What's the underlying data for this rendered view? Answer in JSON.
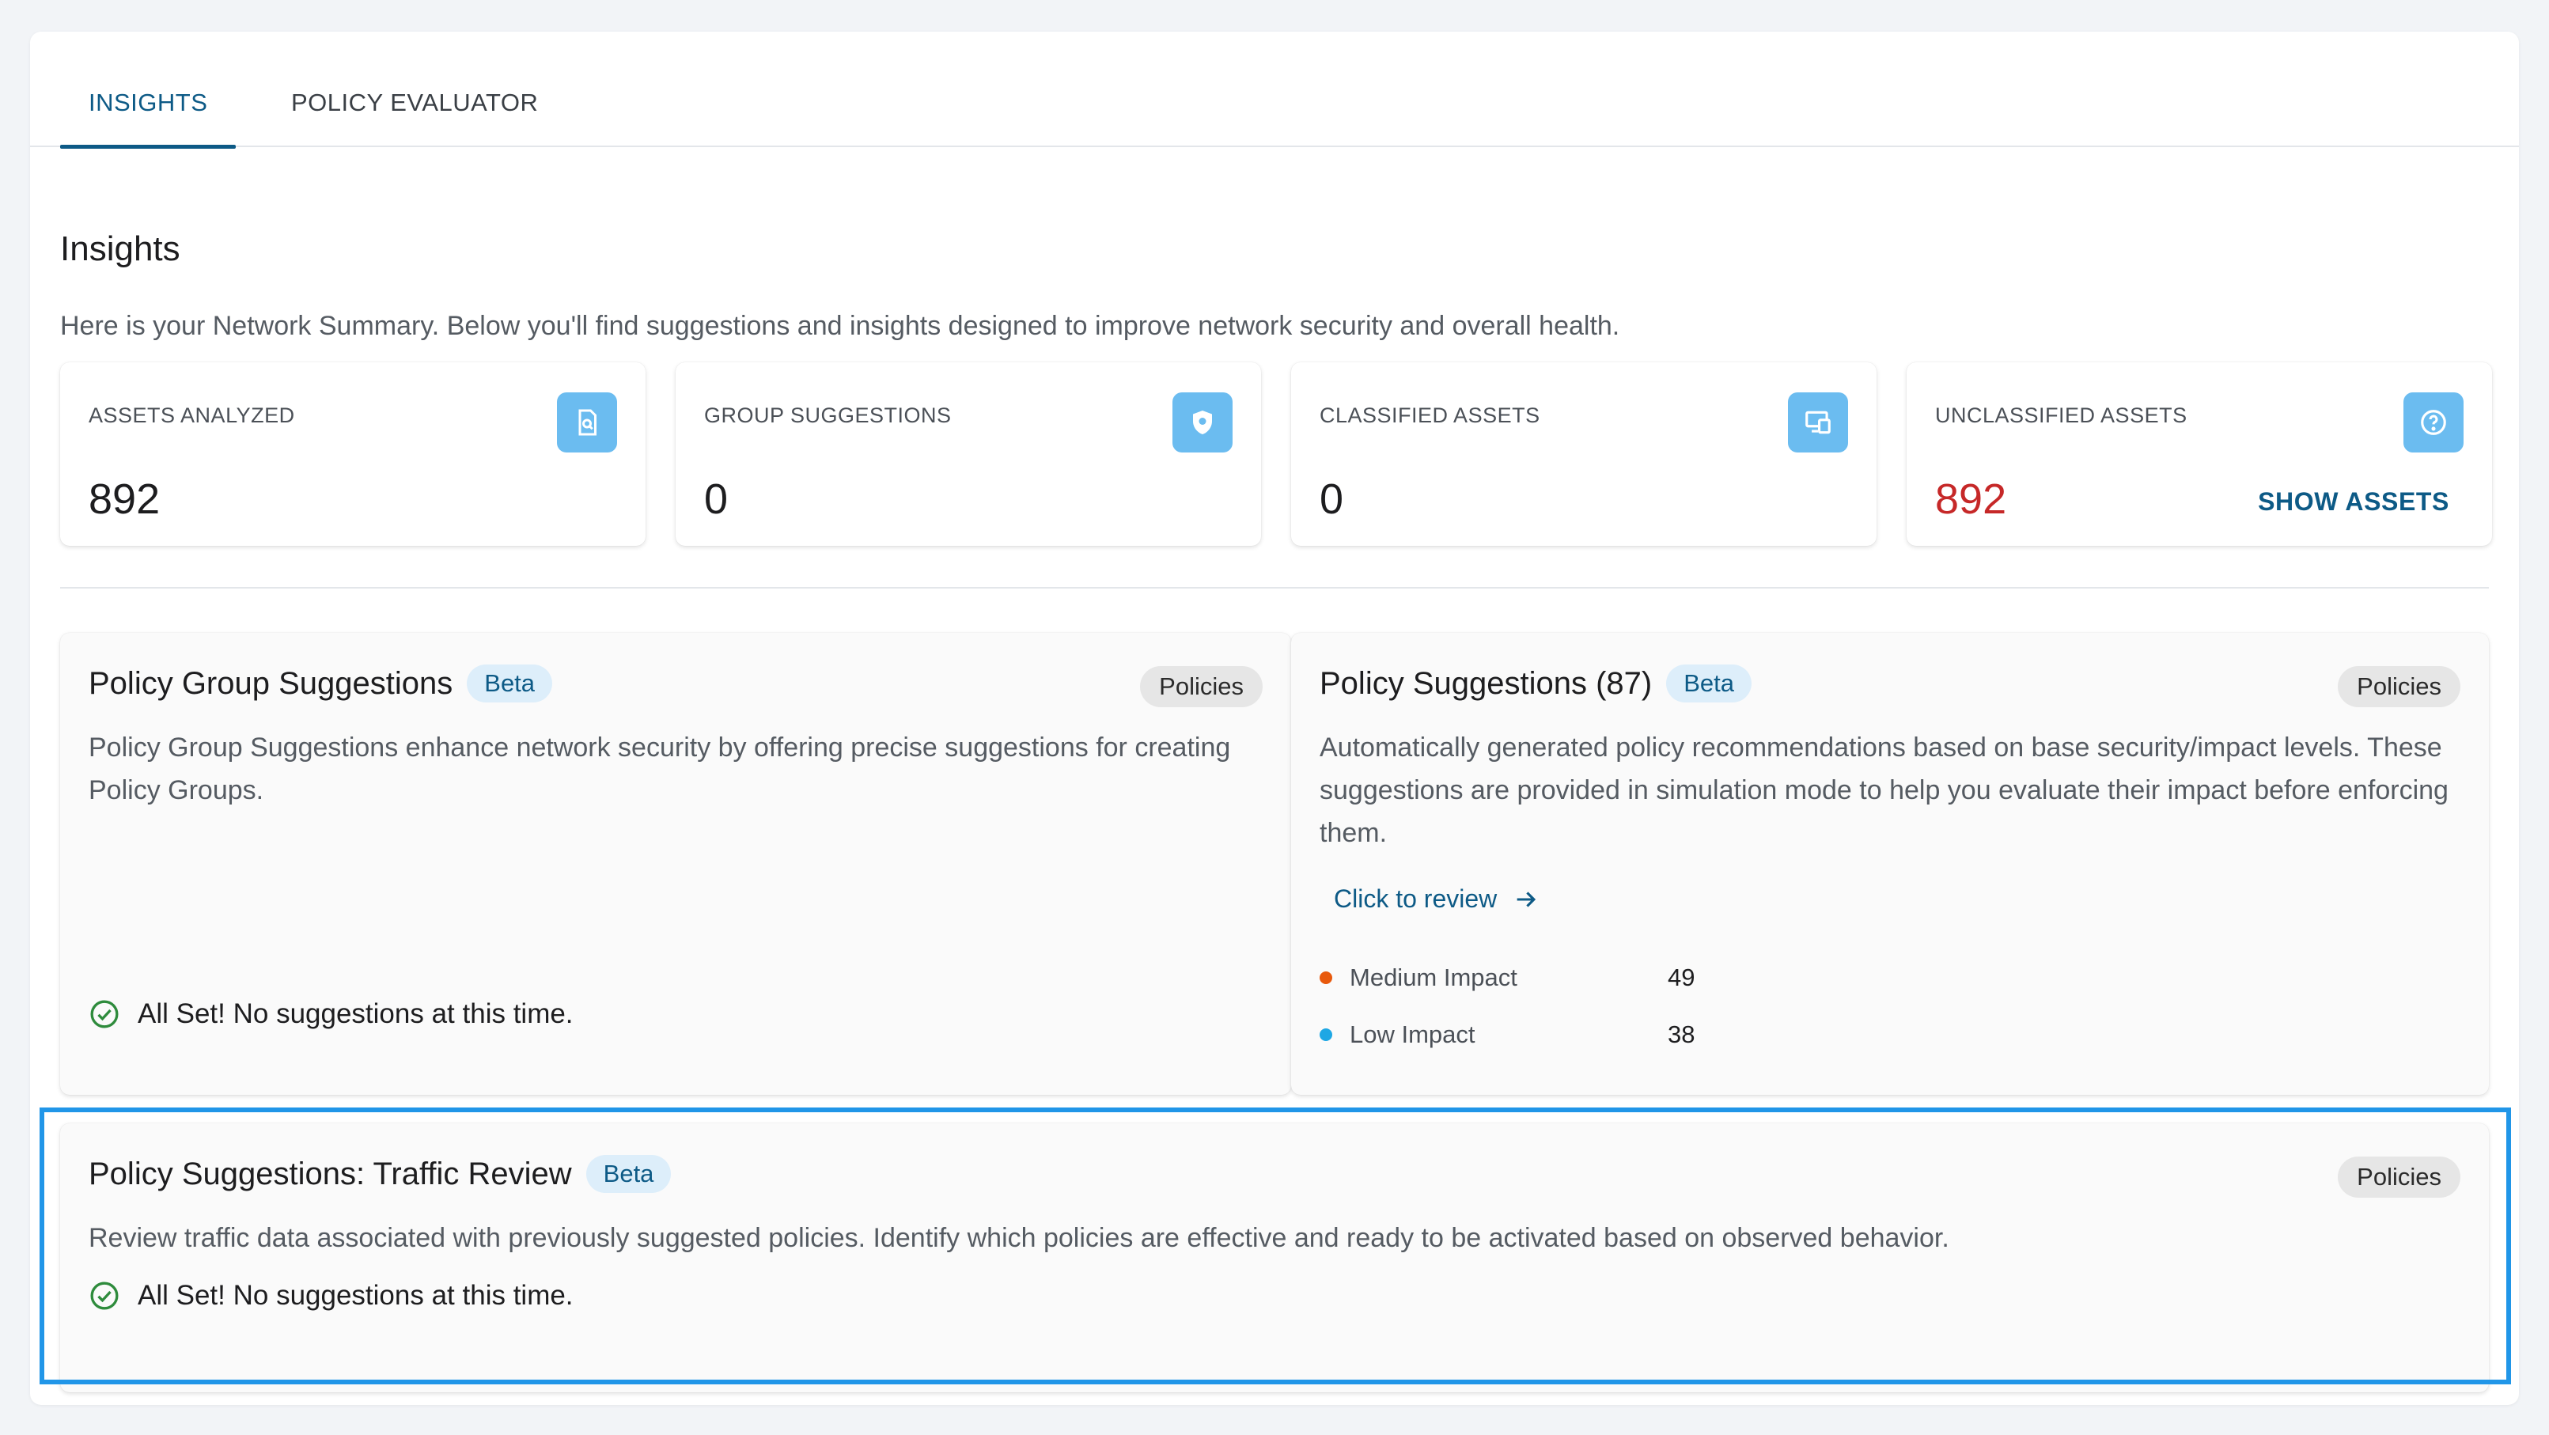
{
  "tabs": [
    {
      "label": "INSIGHTS",
      "active": true
    },
    {
      "label": "POLICY EVALUATOR",
      "active": false
    }
  ],
  "page": {
    "title": "Insights",
    "description": "Here is your Network Summary. Below you'll find suggestions and insights designed to improve network security and overall health."
  },
  "stats": [
    {
      "label": "ASSETS ANALYZED",
      "value": "892",
      "icon": "document-search-icon"
    },
    {
      "label": "GROUP SUGGESTIONS",
      "value": "0",
      "icon": "shield-icon"
    },
    {
      "label": "CLASSIFIED ASSETS",
      "value": "0",
      "icon": "devices-icon"
    },
    {
      "label": "UNCLASSIFIED ASSETS",
      "value": "892",
      "icon": "question-circle-icon",
      "link": "SHOW ASSETS",
      "value_color": "#c62828"
    }
  ],
  "group_suggestions": {
    "title": "Policy Group Suggestions",
    "badge": "Beta",
    "chip": "Policies",
    "description": "Policy Group Suggestions enhance network security by offering precise suggestions for creating Policy Groups.",
    "status": "All Set! No suggestions at this time."
  },
  "policy_suggestions": {
    "title": "Policy Suggestions (87)",
    "badge": "Beta",
    "chip": "Policies",
    "description": "Automatically generated policy recommendations based on base security/impact levels. These suggestions are provided in simulation mode to help you evaluate their impact before enforcing them.",
    "link": "Click to review",
    "impacts": [
      {
        "label": "Medium Impact",
        "count": "49",
        "color": "#e8590c"
      },
      {
        "label": "Low Impact",
        "count": "38",
        "color": "#1ea7e4"
      }
    ]
  },
  "traffic_review": {
    "title": "Policy Suggestions: Traffic Review",
    "badge": "Beta",
    "chip": "Policies",
    "description": "Review traffic data associated with previously suggested policies. Identify which policies are effective and ready to be activated based on observed behavior.",
    "status": "All Set! No suggestions at this time."
  },
  "colors": {
    "accent": "#0d5a86",
    "icon_bg": "#6bbcf0",
    "alert": "#c62828",
    "success": "#2e8b3c",
    "highlight": "#2196e8"
  }
}
